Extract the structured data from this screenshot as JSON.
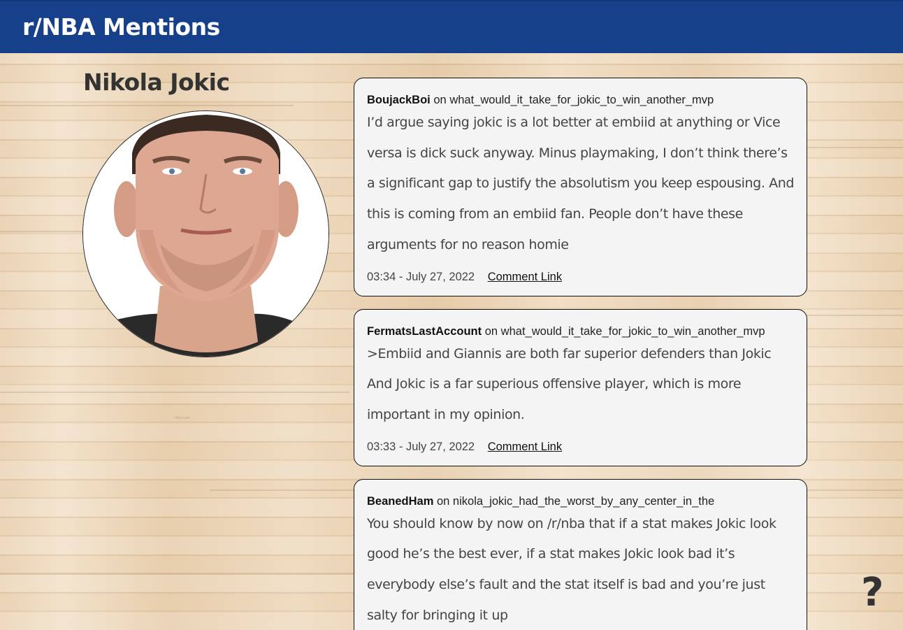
{
  "header": {
    "title": "r/NBA Mentions",
    "bg_color": "#17408b"
  },
  "player": {
    "name": "Nikola Jokic",
    "photo_icon": "player-headshot"
  },
  "comments": [
    {
      "author": "BoujackBoi",
      "on_word": "on",
      "thread": "what_would_it_take_for_jokic_to_win_another_mvp",
      "body": "I’d argue saying jokic is a lot better at embiid at anything or Vice versa is dick suck anyway. Minus playmaking, I don’t think there’s a significant gap to justify the absolutism you keep espousing. And this is coming from an embiid fan. People don’t have these arguments for no reason homie",
      "timestamp": "03:34 - July 27, 2022",
      "link_label": "Comment Link"
    },
    {
      "author": "FermatsLastAccount",
      "on_word": "on",
      "thread": "what_would_it_take_for_jokic_to_win_another_mvp",
      "body": ">Embiid and Giannis are both far superior defenders than Jokic And Jokic is a far superious offensive player, which is more important in my opinion.",
      "timestamp": "03:33 - July 27, 2022",
      "link_label": "Comment Link"
    },
    {
      "author": "BeanedHam",
      "on_word": "on",
      "thread": "nikola_jokic_had_the_worst_by_any_center_in_the",
      "body": "You should know by now on /r/nba that if a stat makes Jokic look good he’s the best ever, if a stat makes Jokic look bad it’s everybody else’s fault and the stat itself is bad and you’re just salty for bringing it up",
      "timestamp": "",
      "link_label": ""
    }
  ],
  "help": {
    "label": "?",
    "icon": "help-question-icon"
  }
}
